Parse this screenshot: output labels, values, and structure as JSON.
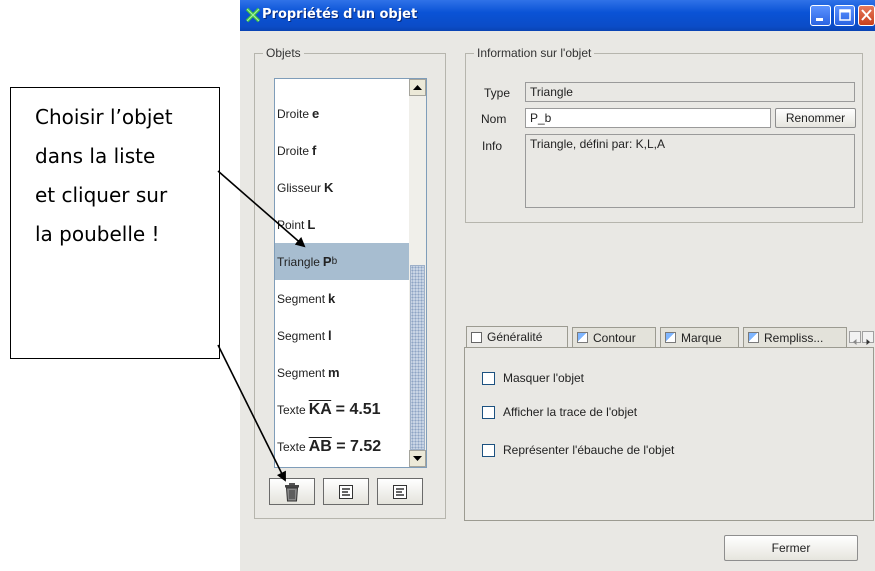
{
  "callout": {
    "lines": [
      "Choisir l’objet",
      "dans la liste",
      "et cliquer sur",
      "la poubelle !"
    ]
  },
  "window": {
    "title": "Propriétés d'un objet"
  },
  "objects_panel": {
    "title": "Objets",
    "items": [
      {
        "type": "Droite",
        "name": "e"
      },
      {
        "type": "Droite",
        "name": "f"
      },
      {
        "type": "Glisseur",
        "name": "K"
      },
      {
        "type": "Point",
        "name": "L"
      },
      {
        "type": "Triangle",
        "name": "P",
        "subscript": "b",
        "selected": true
      },
      {
        "type": "Segment",
        "name": "k"
      },
      {
        "type": "Segment",
        "name": "l"
      },
      {
        "type": "Segment",
        "name": "m"
      },
      {
        "type": "Texte",
        "over": "KA",
        "rest": " = 4.51"
      },
      {
        "type": "Texte",
        "over": "AB",
        "rest": " = 7.52"
      }
    ],
    "buttons": [
      "trash-icon",
      "properties-icon",
      "properties-icon"
    ]
  },
  "info_panel": {
    "title": "Information sur l'objet",
    "type_label": "Type",
    "type_value": "Triangle",
    "name_label": "Nom",
    "name_value": "P_b",
    "rename_button": "Renommer",
    "info_label": "Info",
    "info_value": "Triangle, défini par: K,L,A"
  },
  "tabs": [
    {
      "label": "Généralité",
      "active": true
    },
    {
      "label": "Contour",
      "active": false
    },
    {
      "label": "Marque",
      "active": false
    },
    {
      "label": "Rempliss...",
      "active": false
    }
  ],
  "general_tab": {
    "options": [
      {
        "label": "Masquer l'objet",
        "checked": false
      },
      {
        "label": "Afficher la trace de l'objet",
        "checked": false
      },
      {
        "label": "Représenter l'ébauche de l'objet",
        "checked": false
      }
    ]
  },
  "close_button": "Fermer",
  "colors": {
    "titlebar": "#0a53d6",
    "selection": "#a7bdd0",
    "window_bg": "#e9e8e4"
  }
}
